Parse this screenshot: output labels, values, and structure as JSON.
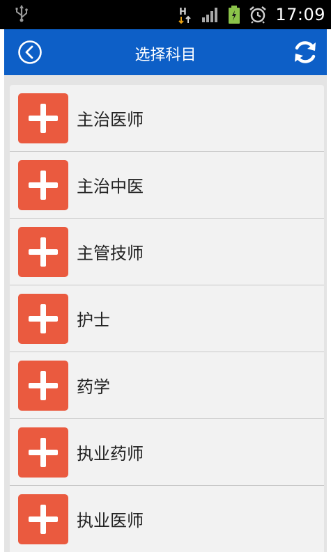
{
  "status_bar": {
    "network_type": "H",
    "time": "17:09",
    "icons": [
      "usb-icon",
      "network-h-icon",
      "signal-icon",
      "battery-icon",
      "alarm-icon"
    ]
  },
  "app_bar": {
    "title": "选择科目",
    "back_icon": "back-arrow-circle-icon",
    "refresh_icon": "refresh-icon",
    "color": "#0d5fc7"
  },
  "list": {
    "tile_color": "#ea5a3f",
    "items": [
      {
        "label": "主治医师"
      },
      {
        "label": "主治中医"
      },
      {
        "label": "主管技师"
      },
      {
        "label": "护士"
      },
      {
        "label": "药学"
      },
      {
        "label": "执业药师"
      },
      {
        "label": "执业医师"
      }
    ]
  }
}
